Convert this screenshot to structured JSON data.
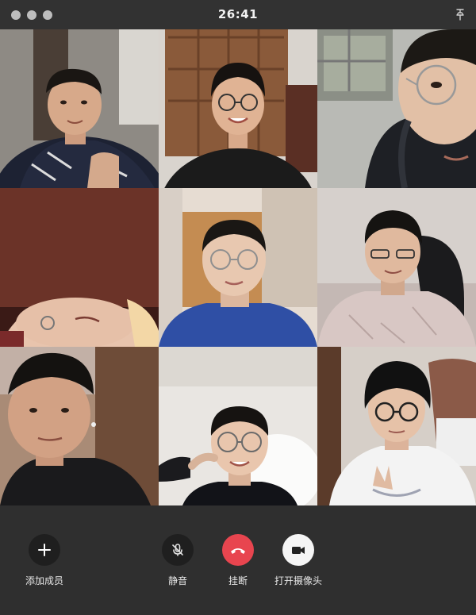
{
  "window": {
    "timer": "26:41",
    "pin_icon": "pin-icon"
  },
  "participants": [
    {
      "id": "p1",
      "bg": "#8e8a84",
      "skin": "#d7a98a",
      "shirt": "#1d2233",
      "hair": "#1a1613"
    },
    {
      "id": "p2",
      "bg": "#8a5a3a",
      "skin": "#e0b394",
      "shirt": "#1b1b1b",
      "hair": "#161210"
    },
    {
      "id": "p3",
      "bg": "#b9bab5",
      "skin": "#e2c0a6",
      "shirt": "#1e2025",
      "hair": "#1c1915"
    },
    {
      "id": "p4",
      "bg": "#5a2a22",
      "skin": "#e8c4ad",
      "shirt": "#7a2a2a",
      "hair": "#2a1814"
    },
    {
      "id": "p5",
      "bg": "#c9a77e",
      "skin": "#e8c8b0",
      "shirt": "#2f4fa5",
      "hair": "#1a1714"
    },
    {
      "id": "p6",
      "bg": "#c4b8b4",
      "skin": "#e0b99e",
      "shirt": "#d8c7c4",
      "hair": "#151311"
    },
    {
      "id": "p7",
      "bg": "#a98b76",
      "skin": "#d2a184",
      "shirt": "#1a1a1c",
      "hair": "#141210"
    },
    {
      "id": "p8",
      "bg": "#e9e6e2",
      "skin": "#e9c6ad",
      "shirt": "#121318",
      "hair": "#161311"
    },
    {
      "id": "p9",
      "bg": "#8b5a48",
      "skin": "#e6c2a8",
      "shirt": "#f3f3f3",
      "hair": "#111"
    }
  ],
  "controls": {
    "add_member": {
      "label": "添加成员",
      "icon": "plus-icon"
    },
    "mute": {
      "label": "静音",
      "icon": "microphone-muted-icon"
    },
    "hangup": {
      "label": "挂断",
      "icon": "phone-hangup-icon"
    },
    "camera": {
      "label": "打开摄像头",
      "icon": "video-camera-icon"
    }
  },
  "colors": {
    "hangup": "#e8454f",
    "control_dark": "#1f1f1f",
    "control_light": "#f5f5f5",
    "background": "#2f2f2f"
  }
}
